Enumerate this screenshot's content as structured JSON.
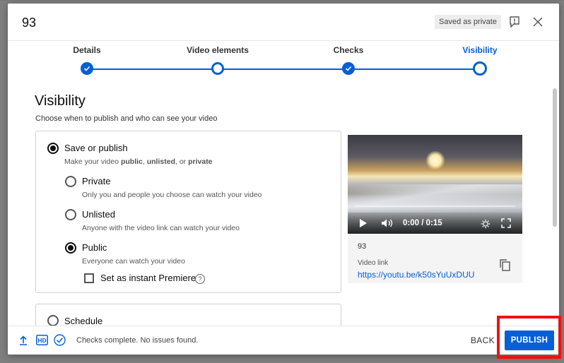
{
  "dialog": {
    "title": "93",
    "saved_badge": "Saved as private",
    "report_icon": "report-flag-icon",
    "close_icon": "close-icon"
  },
  "stepper": {
    "steps": [
      {
        "label": "Details",
        "state": "done"
      },
      {
        "label": "Video elements",
        "state": "visited"
      },
      {
        "label": "Checks",
        "state": "done"
      },
      {
        "label": "Visibility",
        "state": "active"
      }
    ]
  },
  "visibility": {
    "heading": "Visibility",
    "subtitle": "Choose when to publish and who can see your video",
    "save_or_publish": {
      "label": "Save or publish",
      "desc_prefix": "Make your video ",
      "desc_public": "public",
      "desc_sep1": ", ",
      "desc_unlisted": "unlisted",
      "desc_sep2": ", or ",
      "desc_private": "private",
      "selected": true
    },
    "options": [
      {
        "label": "Private",
        "desc": "Only you and people you choose can watch your video",
        "selected": false
      },
      {
        "label": "Unlisted",
        "desc": "Anyone with the video link can watch your video",
        "selected": false
      },
      {
        "label": "Public",
        "desc": "Everyone can watch your video",
        "selected": true
      }
    ],
    "premiere": {
      "label": "Set as instant Premiere",
      "checked": false,
      "help": "?"
    },
    "schedule": {
      "label": "Schedule",
      "selected": false
    }
  },
  "preview": {
    "time": "0:00 / 0:15",
    "video_title": "93",
    "video_link_label": "Video link",
    "video_link": "https://youtu.be/k50sYuUxDUU"
  },
  "footer": {
    "status": "Checks complete. No issues found.",
    "back_label": "BACK",
    "publish_label": "PUBLISH"
  },
  "colors": {
    "accent": "#065fd4",
    "highlight": "#ee1111"
  }
}
